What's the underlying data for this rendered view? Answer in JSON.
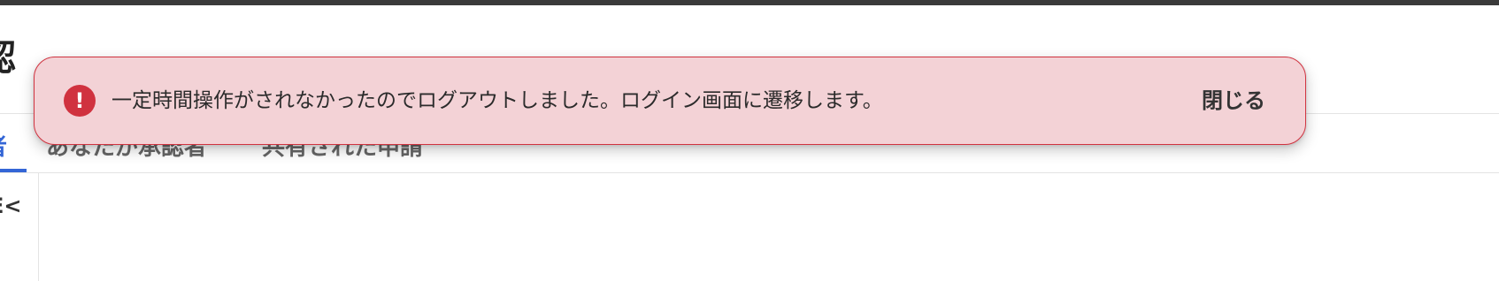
{
  "header": {
    "page_title": "認"
  },
  "tabs": [
    {
      "label": "者",
      "active": true
    },
    {
      "label": "あなたが承認者",
      "active": false
    },
    {
      "label": "共有された申請",
      "active": false
    }
  ],
  "sidebar": {
    "items": [
      {
        "label": "E<"
      }
    ]
  },
  "toast": {
    "icon": "error-icon",
    "icon_glyph": "!",
    "message": "一定時間操作がされなかったのでログアウトしました。ログイン画面に遷移します。",
    "close_label": "閉じる",
    "background_color": "#f3d2d6",
    "border_color": "#d0323f"
  },
  "colors": {
    "accent": "#3466d6",
    "topbar": "#3a3a3a",
    "error": "#d0323f"
  }
}
